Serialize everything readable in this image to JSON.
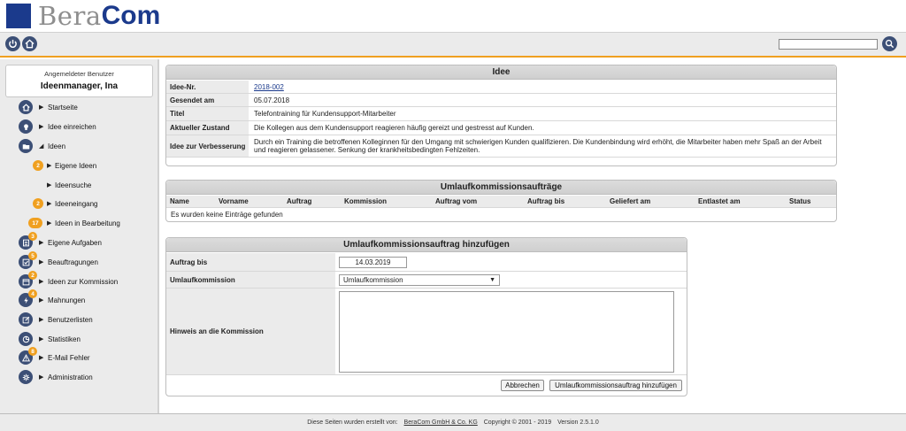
{
  "header": {
    "logo_part1": "Bera",
    "logo_part2": "Com"
  },
  "toolbar": {
    "power_icon": "power-icon",
    "home_icon": "home-icon",
    "search_placeholder": "",
    "search_icon": "search-icon"
  },
  "sidebar": {
    "user_label": "Angemeldeter Benutzer",
    "user_name": "Ideenmanager, Ina",
    "items": [
      {
        "label": "Startseite",
        "icon": "home-icon"
      },
      {
        "label": "Idee einreichen",
        "icon": "lightbulb-icon"
      },
      {
        "label": "Ideen",
        "icon": "folder-icon"
      },
      {
        "label": "Eigene Ideen",
        "badge": "2"
      },
      {
        "label": "Ideensuche"
      },
      {
        "label": "Ideeneingang",
        "badge": "2"
      },
      {
        "label": "Ideen in Bearbeitung",
        "badge": "17"
      },
      {
        "label": "Eigene Aufgaben",
        "icon": "list-icon",
        "badge": "3"
      },
      {
        "label": "Beauftragungen",
        "icon": "check-icon",
        "badge": "5"
      },
      {
        "label": "Ideen zur Kommission",
        "icon": "calendar-icon",
        "badge": "2"
      },
      {
        "label": "Mahnungen",
        "icon": "bolt-icon",
        "badge": "4"
      },
      {
        "label": "Benutzerlisten",
        "icon": "edit-icon"
      },
      {
        "label": "Statistiken",
        "icon": "pie-chart-icon"
      },
      {
        "label": "E-Mail Fehler",
        "icon": "warning-icon",
        "badge": "8"
      },
      {
        "label": "Administration",
        "icon": "gear-icon"
      }
    ]
  },
  "idea_panel": {
    "title": "Idee",
    "rows": [
      {
        "label": "Idee-Nr.",
        "value": "2018-002"
      },
      {
        "label": "Gesendet am",
        "value": "05.07.2018"
      },
      {
        "label": "Titel",
        "value": "Telefontraining für Kundensupport-Mitarbeiter"
      },
      {
        "label": "Aktueller Zustand",
        "value": "Die Kollegen aus dem Kundensupport reagieren häufig gereizt und gestresst auf Kunden."
      },
      {
        "label": "Idee zur Verbesserung",
        "value": "Durch ein Training die betroffenen Kolleginnen für den Umgang mit schwierigen Kunden qualifizieren. Die Kundenbindung wird erhöht, die Mitarbeiter haben mehr Spaß an der Arbeit und reagieren gelassener. Senkung der krankheitsbedingten Fehlzeiten."
      }
    ]
  },
  "orders_panel": {
    "title": "Umlaufkommissionsaufträge",
    "columns": [
      "Name",
      "Vorname",
      "Auftrag",
      "Kommission",
      "Auftrag vom",
      "Auftrag bis",
      "Geliefert am",
      "Entlastet am",
      "Status"
    ],
    "empty_text": "Es wurden keine Einträge gefunden"
  },
  "add_panel": {
    "title": "Umlaufkommissionsauftrag hinzufügen",
    "auftrag_bis_label": "Auftrag bis",
    "auftrag_bis_value": "14.03.2019",
    "kommission_label": "Umlaufkommission",
    "kommission_selected": "Umlaufkommission",
    "hinweis_label": "Hinweis an die Kommission",
    "hinweis_value": "",
    "cancel_label": "Abbrechen",
    "submit_label": "Umlaufkommissionsauftrag hinzufügen"
  },
  "footer": {
    "prefix": "Diese Seiten wurden erstellt von:",
    "company": "BeraCom GmbH & Co. KG",
    "copyright": "Copyright © 2001 - 2019",
    "version": "Version  2.5.1.0"
  },
  "colors": {
    "brand_blue": "#1b3a8c",
    "icon_blue": "#3c4f76",
    "badge_orange": "#f0a020"
  }
}
